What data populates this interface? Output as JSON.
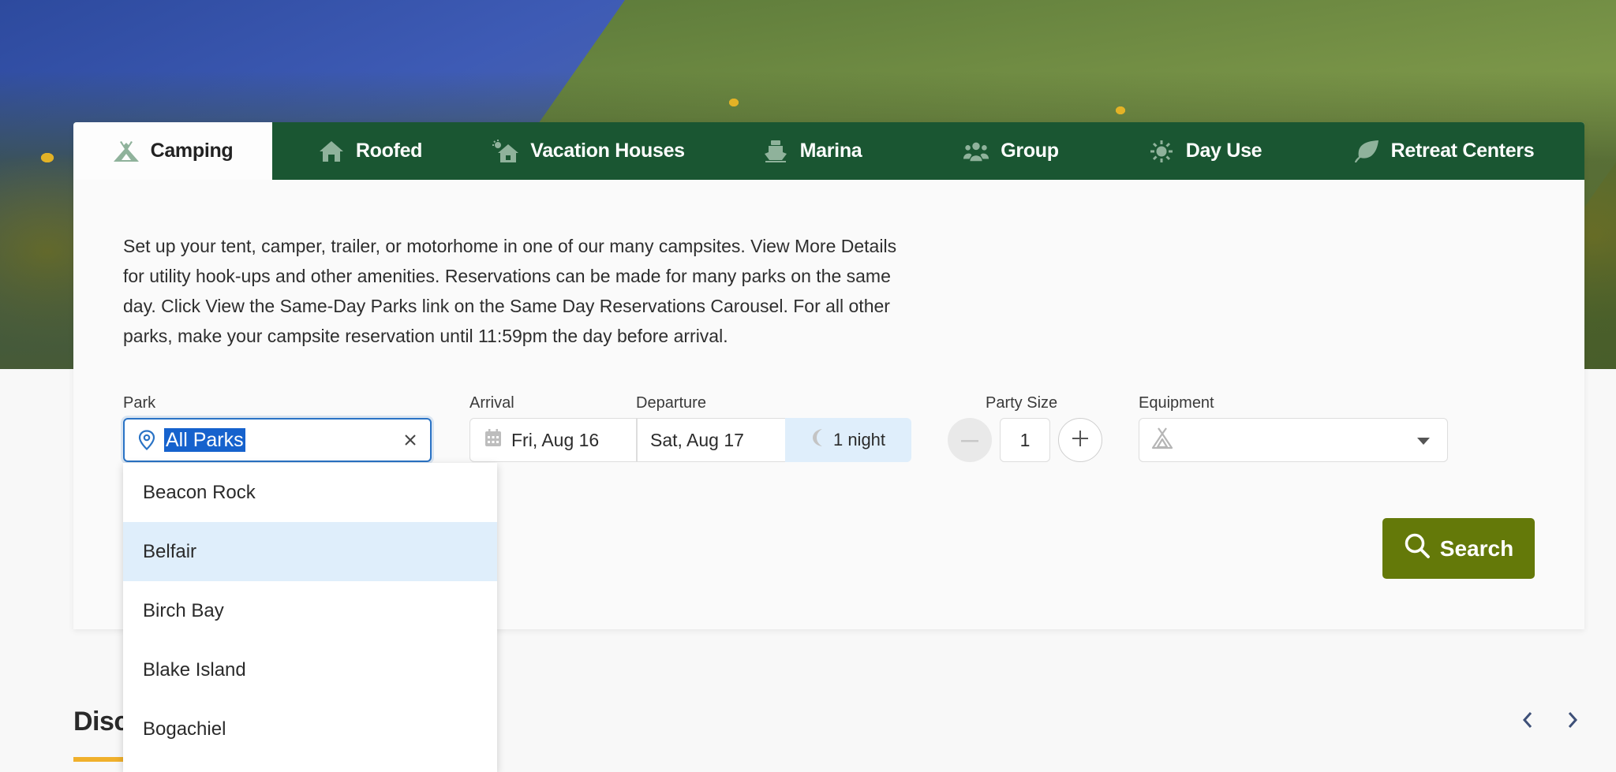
{
  "tabs": [
    {
      "label": "Camping",
      "icon": "tent-icon",
      "active": true
    },
    {
      "label": "Roofed",
      "icon": "house-icon",
      "active": false
    },
    {
      "label": "Vacation Houses",
      "icon": "vacation-house-icon",
      "active": false
    },
    {
      "label": "Marina",
      "icon": "boat-icon",
      "active": false
    },
    {
      "label": "Group",
      "icon": "group-icon",
      "active": false
    },
    {
      "label": "Day Use",
      "icon": "sun-icon",
      "active": false
    },
    {
      "label": "Retreat Centers",
      "icon": "leaf-icon",
      "active": false
    }
  ],
  "description": "Set up your tent, camper, trailer, or motorhome in one of our many campsites. View More Details for utility hook-ups and other amenities. Reservations can be made for many parks on the same day. Click View the Same-Day Parks link on the Same Day Reservations Carousel. For all other parks, make your campsite reservation until 11:59pm the day before arrival.",
  "form": {
    "park": {
      "label": "Park",
      "value": "All Parks"
    },
    "arrival": {
      "label": "Arrival",
      "value": "Fri, Aug 16"
    },
    "departure": {
      "label": "Departure",
      "value": "Sat, Aug 17"
    },
    "nights": "1 night",
    "party_size": {
      "label": "Party Size",
      "value": "1"
    },
    "equipment": {
      "label": "Equipment",
      "value": ""
    },
    "search_label": "Search"
  },
  "park_options": [
    {
      "label": "Beacon Rock",
      "highlighted": false
    },
    {
      "label": "Belfair",
      "highlighted": true
    },
    {
      "label": "Birch Bay",
      "highlighted": false
    },
    {
      "label": "Blake Island",
      "highlighted": false
    },
    {
      "label": "Bogachiel",
      "highlighted": false
    }
  ],
  "discover": {
    "title": "Disc"
  },
  "colors": {
    "tab_bar": "#1a5632",
    "search_button": "#647909",
    "focus_blue": "#2a73c5",
    "highlight": "#dfeefb",
    "accent_underline": "#f0b02c"
  }
}
